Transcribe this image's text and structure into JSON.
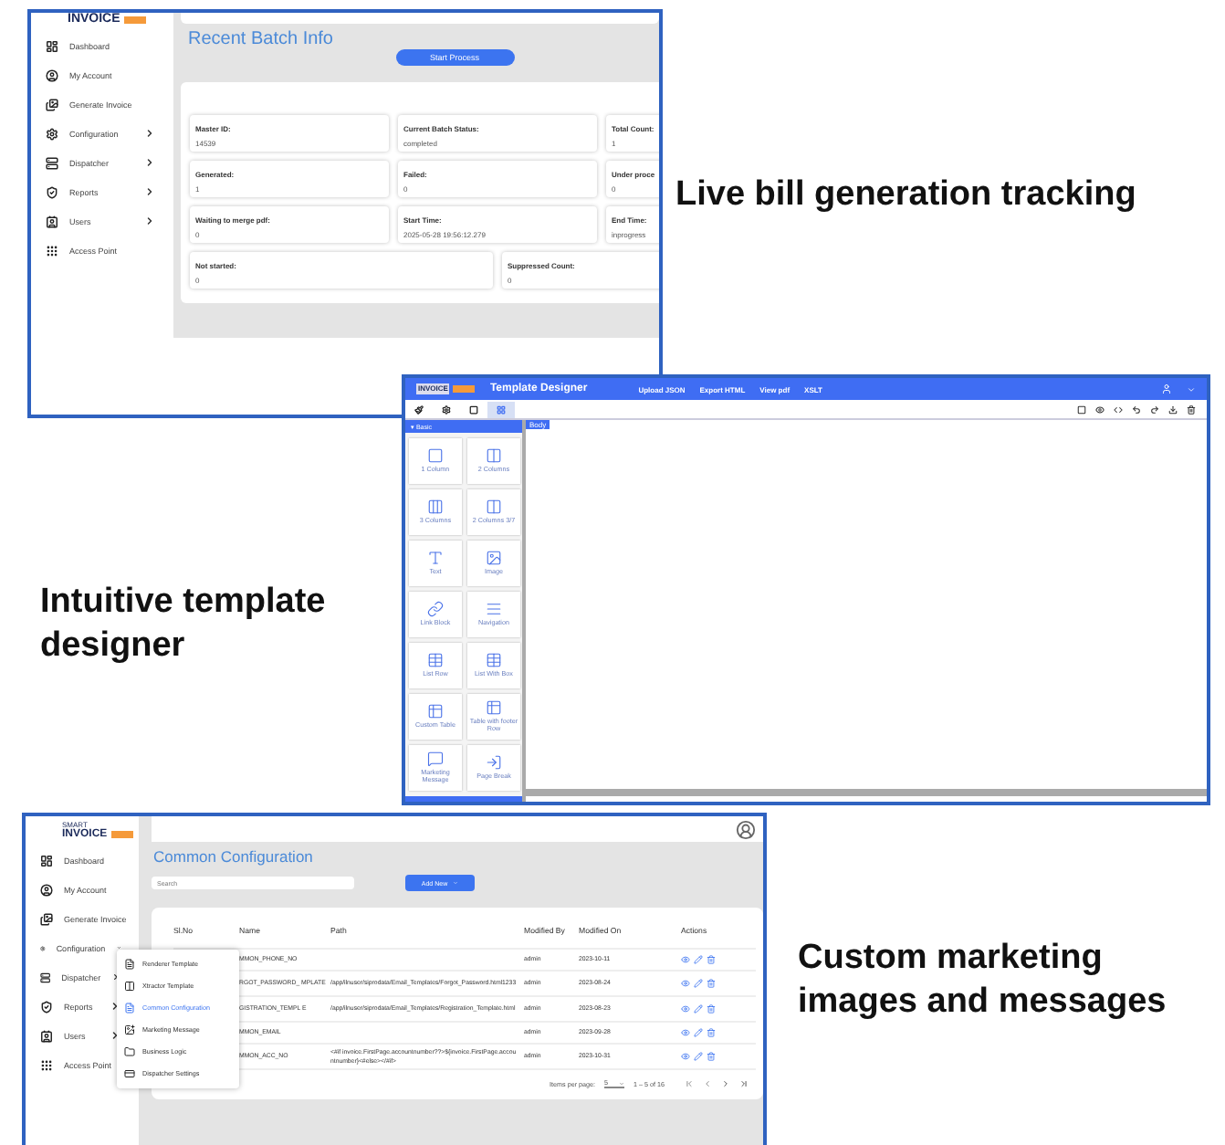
{
  "batch_screen": {
    "logo": "INVOICE",
    "nav": [
      {
        "label": "Dashboard",
        "kind": "plain"
      },
      {
        "label": "My Account",
        "kind": "plain"
      },
      {
        "label": "Generate Invoice",
        "kind": "plain"
      },
      {
        "label": "Configuration",
        "kind": "collapsed"
      },
      {
        "label": "Dispatcher",
        "kind": "collapsed"
      },
      {
        "label": "Reports",
        "kind": "collapsed"
      },
      {
        "label": "Users",
        "kind": "collapsed"
      },
      {
        "label": "Access Point",
        "kind": "plain"
      }
    ],
    "title": "Recent Batch Info",
    "button": "Start Process",
    "fields": [
      {
        "label": "Master ID:",
        "value": "14539",
        "wide": false
      },
      {
        "label": "Current Batch Status:",
        "value": "completed",
        "wide": false
      },
      {
        "label": "Total Count:",
        "value": "1",
        "wide": false
      },
      {
        "label": "Generated:",
        "value": "1",
        "wide": false
      },
      {
        "label": "Failed:",
        "value": "0",
        "wide": false
      },
      {
        "label": "Under proce",
        "value": "0",
        "wide": false
      },
      {
        "label": "Waiting to merge pdf:",
        "value": "0",
        "wide": false
      },
      {
        "label": "Start Time:",
        "value": "2025-05-28 19:56:12.279",
        "wide": false
      },
      {
        "label": "End Time:",
        "value": "inprogress",
        "wide": false
      },
      {
        "label": "Not started:",
        "value": "0",
        "wide": true
      },
      {
        "label": "Suppressed Count:",
        "value": "0",
        "wide": true
      }
    ],
    "caption": "Live bill generation tracking"
  },
  "designer_screen": {
    "logo": "INVOICE",
    "title": "Template Designer",
    "menu": [
      "Upload JSON",
      "Export HTML",
      "View pdf",
      "XSLT"
    ],
    "toolbar_tabs": [
      {
        "selected": false
      },
      {
        "selected": false
      },
      {
        "selected": false
      },
      {
        "selected": true
      }
    ],
    "panel_header": "▾ Basic",
    "blocks": [
      "1 Column",
      "2 Columns",
      "3 Columns",
      "2 Columns 3/7",
      "Text",
      "Image",
      "Link Block",
      "Navigation",
      "List Row",
      "List With Box",
      "Custom Table",
      "Table with footer Row",
      "Marketing Message",
      "Page Break"
    ],
    "canvas_tag": "Body",
    "caption": "Intuitive template designer"
  },
  "config_screen": {
    "logo_top": "SMART",
    "logo": "INVOICE",
    "nav": [
      {
        "label": "Dashboard",
        "kind": "plain"
      },
      {
        "label": "My Account",
        "kind": "plain"
      },
      {
        "label": "Generate Invoice",
        "kind": "plain"
      },
      {
        "label": "Configuration",
        "kind": "expanded"
      },
      {
        "label": "Dispatcher",
        "kind": "collapsed"
      },
      {
        "label": "Reports",
        "kind": "collapsed"
      },
      {
        "label": "Users",
        "kind": "collapsed"
      },
      {
        "label": "Access Point",
        "kind": "plain"
      }
    ],
    "submenu": [
      {
        "label": "Renderer Template",
        "selected": false
      },
      {
        "label": "Xtractor Template",
        "selected": false
      },
      {
        "label": "Common Configuration",
        "selected": true
      },
      {
        "label": "Marketing Message",
        "selected": false
      },
      {
        "label": "Business Logic",
        "selected": false
      },
      {
        "label": "Dispatcher Settings",
        "selected": false
      }
    ],
    "title": "Common Configuration",
    "search": {
      "placeholder": "Search"
    },
    "add_button": "Add New",
    "columns": [
      "Sl.No",
      "Name",
      "Path",
      "Modified By",
      "Modified On",
      "Actions"
    ],
    "rows": [
      {
        "name": "MMON_PHONE_NO",
        "path": "",
        "by": "admin",
        "on": "2023-10-11"
      },
      {
        "name": "RGOT_PASSWORD_ MPLATE",
        "path": "/app/ilnuser/siprodata/Email_Templates/Forgot_Password.html1233",
        "by": "admin",
        "on": "2023-08-24"
      },
      {
        "name": "GISTRATION_TEMPL E",
        "path": "/app/ilnuser/siprodata/Email_Templates/Registration_Template.html",
        "by": "admin",
        "on": "2023-08-23"
      },
      {
        "name": "MMON_EMAIL",
        "path": "",
        "by": "admin",
        "on": "2023-09-28"
      },
      {
        "name": "MMON_ACC_NO",
        "path": "<#if invoice.FirstPage.accountnumber??>${invoice.FirstPage.accountnumber}<#else></#if>",
        "by": "admin",
        "on": "2023-10-31"
      }
    ],
    "pagination": {
      "label": "Items per page:",
      "size": "5",
      "range": "1 – 5 of 16"
    },
    "caption": "Custom marketing images and messages"
  }
}
